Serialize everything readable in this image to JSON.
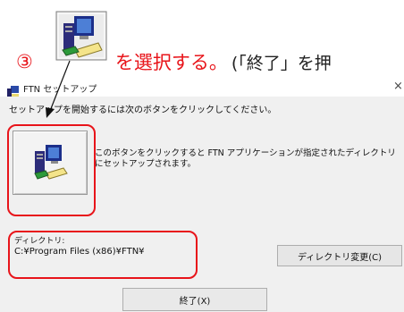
{
  "annotation": {
    "step_number": "③",
    "text_red": "を選択する。",
    "text_black": "(「終了」を押"
  },
  "window": {
    "title": "FTN セットアップ",
    "close_glyph": "×"
  },
  "main": {
    "prompt": "セットアップを開始するには次のボタンをクリックしてください。",
    "setup_button_description": "このボタンをクリックすると FTN アプリケーションが指定されたディレクトリにセットアップされます。",
    "directory_label": "ディレクトリ:",
    "directory_value": "C:¥Program Files (x86)¥FTN¥",
    "change_directory_button": "ディレクトリ変更(C)",
    "exit_button": "終了(X)"
  },
  "colors": {
    "annotation_red": "#e8141a",
    "window_bg": "#f0f0f0"
  },
  "icons": [
    "setup-computer-icon",
    "app-icon",
    "close-icon"
  ]
}
